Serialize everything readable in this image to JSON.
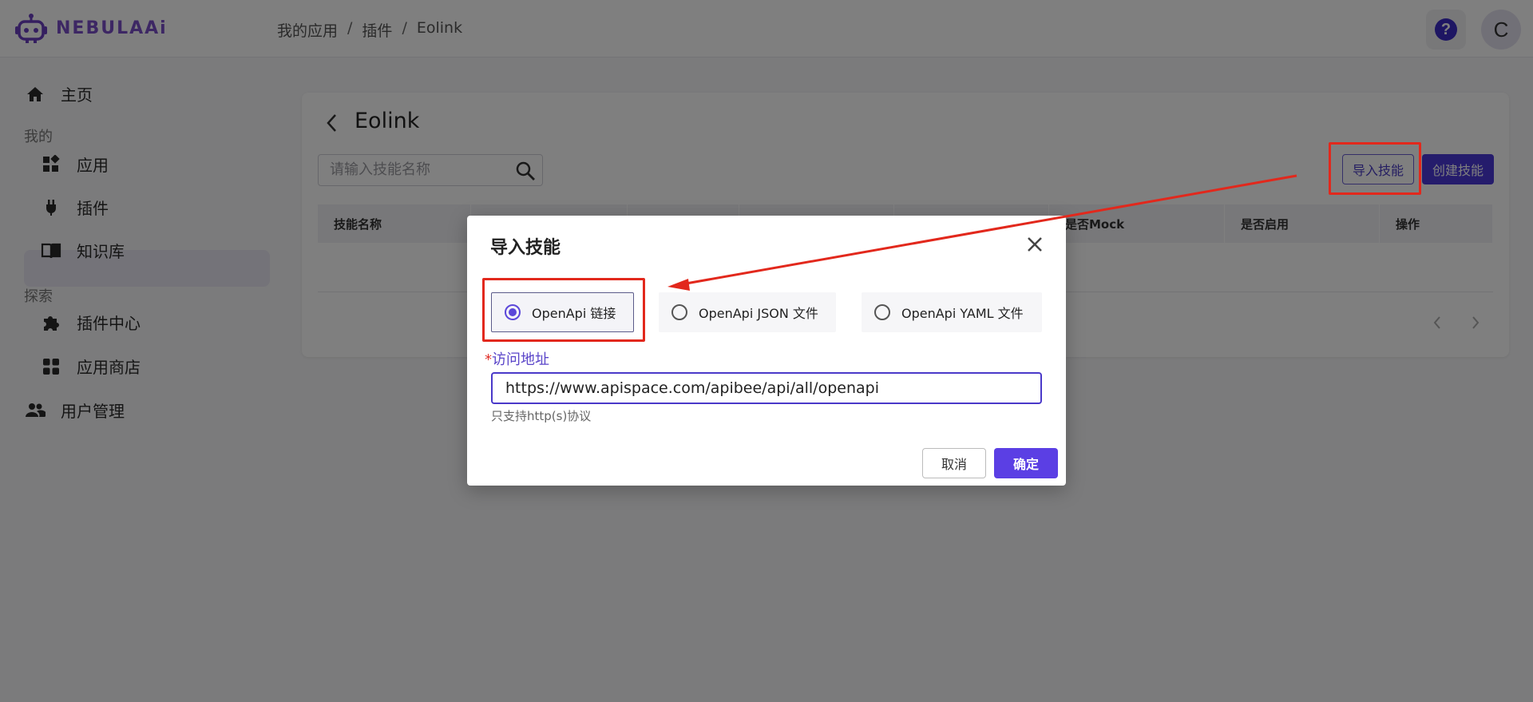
{
  "brand": {
    "name": "NEBULAAi"
  },
  "breadcrumb": {
    "items": [
      "我的应用",
      "插件",
      "Eolink"
    ],
    "separator": "/"
  },
  "header": {
    "help_symbol": "?",
    "avatar_initial": "C"
  },
  "sidebar": {
    "home": "主页",
    "section_mine": "我的",
    "apps": "应用",
    "plugins": "插件",
    "knowledge": "知识库",
    "section_explore": "探索",
    "plugin_center": "插件中心",
    "app_store": "应用商店",
    "user_management": "用户管理"
  },
  "page": {
    "title": "Eolink",
    "search_placeholder": "请输入技能名称",
    "import_button": "导入技能",
    "create_button": "创建技能",
    "columns": [
      "技能名称",
      "",
      "",
      "",
      "",
      "是否Mock",
      "是否启用",
      "操作"
    ]
  },
  "modal": {
    "title": "导入技能",
    "options": [
      "OpenApi 链接",
      "OpenApi JSON 文件",
      "OpenApi YAML 文件"
    ],
    "selected_option": "OpenApi 链接",
    "field_required_mark": "*",
    "field_label": "访问地址",
    "url_value": "https://www.apispace.com/apibee/api/all/openapi",
    "hint": "只支持http(s)协议",
    "cancel": "取消",
    "confirm": "确定"
  },
  "colors": {
    "accent": "#5b3fe4",
    "brand": "#7a4ec8",
    "annotation": "#e2281c"
  }
}
